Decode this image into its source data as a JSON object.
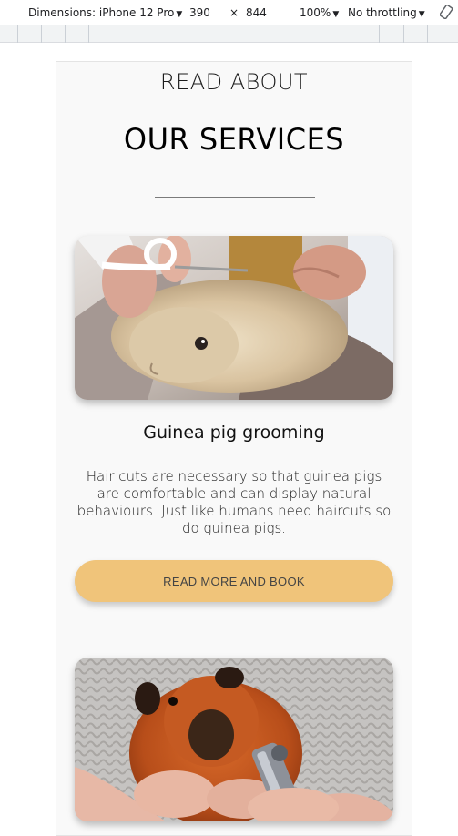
{
  "devtools": {
    "device_label": "Dimensions: iPhone 12 Pro",
    "width": "390",
    "times": "×",
    "height": "844",
    "zoom": "100%",
    "throttling": "No throttling"
  },
  "section": {
    "kicker": "READ ABOUT",
    "headline": "OUR SERVICES"
  },
  "services": [
    {
      "title": "Guinea pig grooming",
      "description": "Hair cuts are necessary so that guinea pigs are comfortable and can display natural behaviours. Just like humans need haircuts so do guinea pigs.",
      "button_label": "READ MORE AND BOOK"
    }
  ],
  "colors": {
    "accent": "#f0c47a",
    "page_bg": "#f9f9f9"
  }
}
